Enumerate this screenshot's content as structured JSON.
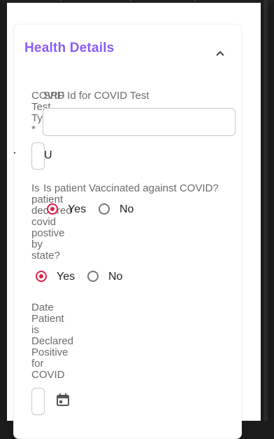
{
  "section": {
    "title": "Health Details"
  },
  "fields": {
    "srf_id_label": "SRF Id for COVID Test",
    "test_type_label_lines": [
      "COVID",
      "Test",
      "Type",
      "*"
    ],
    "test_type_value": "U",
    "vaccinated_label": "Is patient Vaccinated against COVID?",
    "declared_label_lines": [
      "Is",
      "patient",
      "declared",
      "covid",
      "postive",
      "by",
      "state?"
    ],
    "vaccinated_options": {
      "yes": "Yes",
      "no": "No",
      "selected": "yes"
    },
    "declared_options": {
      "yes": "Yes",
      "no": "No",
      "selected": "yes"
    },
    "date_label_lines": [
      "Date",
      "Patient",
      "is",
      "Declared",
      "Positive",
      "for",
      "COVID"
    ]
  },
  "icons": {
    "collapse": "chevron-up-icon",
    "calendar": "calendar-icon"
  },
  "colors": {
    "accent": "#8b5cf6",
    "radio_selected": "#e11d48"
  }
}
